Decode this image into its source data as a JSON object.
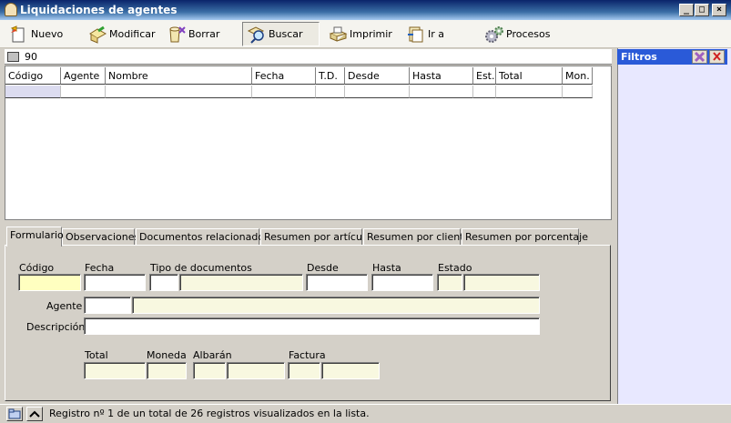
{
  "window": {
    "title": "Liquidaciones de agentes"
  },
  "toolbar": {
    "nuevo": "Nuevo",
    "modificar": "Modificar",
    "borrar": "Borrar",
    "buscar": "Buscar",
    "imprimir": "Imprimir",
    "ir_a": "Ir a",
    "procesos": "Procesos"
  },
  "search": {
    "value": "90"
  },
  "grid": {
    "columns": [
      "Código",
      "Agente",
      "Nombre",
      "Fecha",
      "T.D.",
      "Desde",
      "Hasta",
      "Est.",
      "Total",
      "Mon."
    ]
  },
  "tabs": [
    "Formulario",
    "Observaciones",
    "Documentos relacionados",
    "Resumen por artículo",
    "Resumen por cliente",
    "Resumen por porcentaje"
  ],
  "form": {
    "codigo": "Código",
    "fecha": "Fecha",
    "tipo_documentos": "Tipo de documentos",
    "desde": "Desde",
    "hasta": "Hasta",
    "estado": "Estado",
    "agente": "Agente",
    "descripcion": "Descripción",
    "total": "Total",
    "moneda": "Moneda",
    "albaran": "Albarán",
    "factura": "Factura"
  },
  "status": {
    "text": "Registro nº 1 de un total de 26 registros visualizados en la lista."
  },
  "filtros": {
    "title": "Filtros"
  },
  "icons": {
    "nuevo": "new-document-icon",
    "modificar": "edit-icon",
    "borrar": "delete-icon",
    "buscar": "search-icon",
    "imprimir": "printer-icon",
    "ir_a": "goto-icon",
    "procesos": "gears-icon"
  },
  "colors": {
    "title_bar": "#0a246a",
    "filtros_header": "#2a5ad8",
    "field_bg": "#f8f8e0",
    "required_field": "#ffffc0"
  }
}
